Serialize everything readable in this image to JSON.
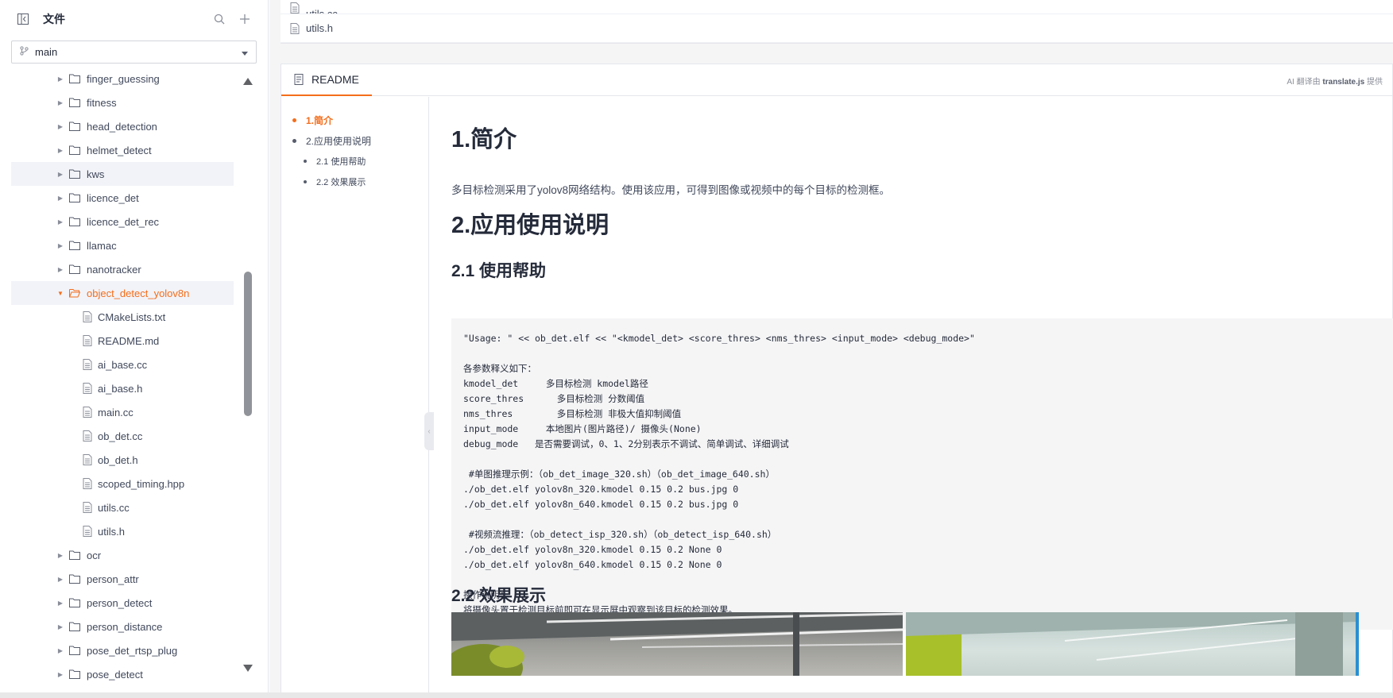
{
  "sidebar": {
    "title": "文件",
    "branch": "main",
    "tree": [
      {
        "label": "finger_guessing",
        "type": "folder"
      },
      {
        "label": "fitness",
        "type": "folder"
      },
      {
        "label": "head_detection",
        "type": "folder"
      },
      {
        "label": "helmet_detect",
        "type": "folder"
      },
      {
        "label": "kws",
        "type": "folder",
        "state": "hover"
      },
      {
        "label": "licence_det",
        "type": "folder"
      },
      {
        "label": "licence_det_rec",
        "type": "folder"
      },
      {
        "label": "llamac",
        "type": "folder"
      },
      {
        "label": "nanotracker",
        "type": "folder"
      },
      {
        "label": "object_detect_yolov8n",
        "type": "folder",
        "state": "open"
      },
      {
        "label": "CMakeLists.txt",
        "type": "file"
      },
      {
        "label": "README.md",
        "type": "file"
      },
      {
        "label": "ai_base.cc",
        "type": "file"
      },
      {
        "label": "ai_base.h",
        "type": "file"
      },
      {
        "label": "main.cc",
        "type": "file"
      },
      {
        "label": "ob_det.cc",
        "type": "file"
      },
      {
        "label": "ob_det.h",
        "type": "file"
      },
      {
        "label": "scoped_timing.hpp",
        "type": "file"
      },
      {
        "label": "utils.cc",
        "type": "file"
      },
      {
        "label": "utils.h",
        "type": "file"
      },
      {
        "label": "ocr",
        "type": "folder"
      },
      {
        "label": "person_attr",
        "type": "folder"
      },
      {
        "label": "person_detect",
        "type": "folder"
      },
      {
        "label": "person_distance",
        "type": "folder"
      },
      {
        "label": "pose_det_rtsp_plug",
        "type": "folder"
      },
      {
        "label": "pose_detect",
        "type": "folder"
      }
    ]
  },
  "files": {
    "row1": "utils.cc",
    "row2": "utils.h"
  },
  "readme": {
    "tab_label": "README",
    "translate_prefix": "AI 翻译由",
    "translate_brand": "translate.js",
    "translate_suffix": "提供",
    "toc": [
      {
        "label": "1.简介",
        "active": true,
        "sub": false
      },
      {
        "label": "2.应用使用说明",
        "active": false,
        "sub": false
      },
      {
        "label": "2.1 使用帮助",
        "active": false,
        "sub": true
      },
      {
        "label": "2.2 效果展示",
        "active": false,
        "sub": true
      }
    ],
    "h1_intro": "1.简介",
    "p_intro": "多目标检测采用了yolov8网络结构。使用该应用，可得到图像或视频中的每个目标的检测框。",
    "h1_usage": "2.应用使用说明",
    "h2_help": "2.1 使用帮助",
    "code_lines": [
      "\"Usage: \" << ob_det.elf << \"<kmodel_det> <score_thres> <nms_thres> <input_mode> <debug_mode>\"",
      "",
      "各参数释义如下：",
      "kmodel_det     多目标检测 kmodel路径",
      "score_thres      多目标检测 分数阈值",
      "nms_thres        多目标检测 非极大值抑制阈值",
      "input_mode     本地图片(图片路径)/ 摄像头(None)",
      "debug_mode   是否需要调试，0、1、2分别表示不调试、简单调试、详细调试",
      "",
      " #单图推理示例：（ob_det_image_320.sh）（ob_det_image_640.sh）",
      "./ob_det.elf yolov8n_320.kmodel 0.15 0.2 bus.jpg 0",
      "./ob_det.elf yolov8n_640.kmodel 0.15 0.2 bus.jpg 0",
      "",
      " #视频流推理：（ob_detect_isp_320.sh）（ob_detect_isp_640.sh）",
      "./ob_det.elf yolov8n_320.kmodel 0.15 0.2 None 0",
      "./ob_det.elf yolov8n_640.kmodel 0.15 0.2 None 0",
      "",
      "操作说明：",
      "将摄像头置于检测目标前即可在显示屏中观察到该目标的检测效果。"
    ],
    "h2_effect": "2.2 效果展示"
  },
  "colors": {
    "accent": "#f46d1b",
    "text": "#40485b",
    "heading": "#252b3a"
  }
}
